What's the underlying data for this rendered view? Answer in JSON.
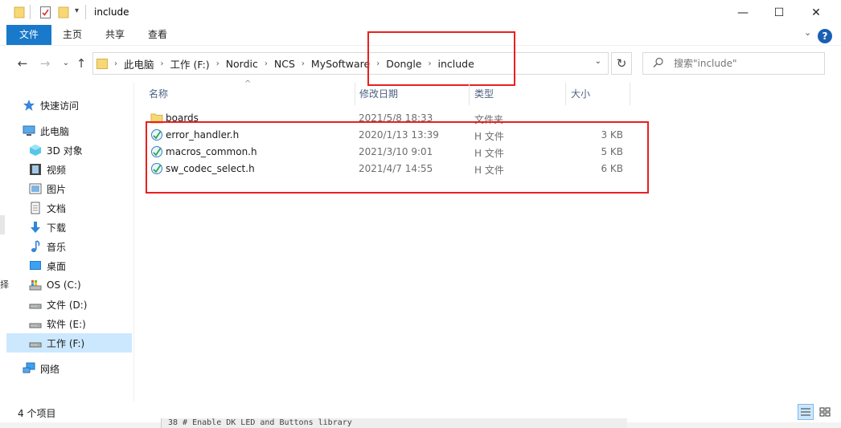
{
  "window": {
    "title": "include",
    "minimize": "—",
    "maximize": "☐",
    "close": "✕"
  },
  "ribbon": {
    "tabs": [
      "文件",
      "主页",
      "共享",
      "查看"
    ],
    "expand_glyph": "⌄",
    "help": "?"
  },
  "nav": {
    "back": "←",
    "forward": "→",
    "recent": "⌄",
    "up": "↑",
    "refresh": "↻",
    "breadcrumbs": [
      "此电脑",
      "工作 (F:)",
      "Nordic",
      "NCS",
      "MySoftware",
      "Dongle",
      "include"
    ],
    "separator": "›",
    "dropdown": "⌄"
  },
  "search": {
    "placeholder": "搜索\"include\"",
    "icon": "search-icon"
  },
  "sidebar": {
    "items": [
      {
        "label": "快速访问",
        "icon": "star-icon"
      },
      {
        "label": "此电脑",
        "icon": "computer-icon"
      },
      {
        "label": "3D 对象",
        "icon": "cube-icon"
      },
      {
        "label": "视频",
        "icon": "video-icon"
      },
      {
        "label": "图片",
        "icon": "picture-icon"
      },
      {
        "label": "文档",
        "icon": "document-icon"
      },
      {
        "label": "下载",
        "icon": "download-icon"
      },
      {
        "label": "音乐",
        "icon": "music-icon"
      },
      {
        "label": "桌面",
        "icon": "desktop-icon"
      },
      {
        "label": "OS (C:)",
        "icon": "os-drive-icon"
      },
      {
        "label": "文件 (D:)",
        "icon": "drive-icon"
      },
      {
        "label": "软件 (E:)",
        "icon": "drive-icon"
      },
      {
        "label": "工作 (F:)",
        "icon": "drive-icon",
        "selected": true
      },
      {
        "label": "网络",
        "icon": "network-icon"
      }
    ]
  },
  "columns": {
    "name": "名称",
    "date": "修改日期",
    "type": "类型",
    "size": "大小",
    "sort_glyph": "^"
  },
  "files": [
    {
      "name": "boards",
      "date": "2021/5/8 18:33",
      "type": "文件夹",
      "size": "",
      "icon": "folder-icon"
    },
    {
      "name": "error_handler.h",
      "date": "2020/1/13 13:39",
      "type": "H 文件",
      "size": "3 KB",
      "icon": "h-file-icon"
    },
    {
      "name": "macros_common.h",
      "date": "2021/3/10 9:01",
      "type": "H 文件",
      "size": "5 KB",
      "icon": "h-file-icon"
    },
    {
      "name": "sw_codec_select.h",
      "date": "2021/4/7 14:55",
      "type": "H 文件",
      "size": "6 KB",
      "icon": "h-file-icon"
    }
  ],
  "status": {
    "item_count": "4 个项目"
  },
  "background_code": "38  # Enable DK LED and Buttons library",
  "left_edge_char": "择",
  "colors": {
    "accent": "#1979ca",
    "selected": "#cce8ff",
    "annotation_red": "#e8201f",
    "folder": "#f8d775"
  }
}
